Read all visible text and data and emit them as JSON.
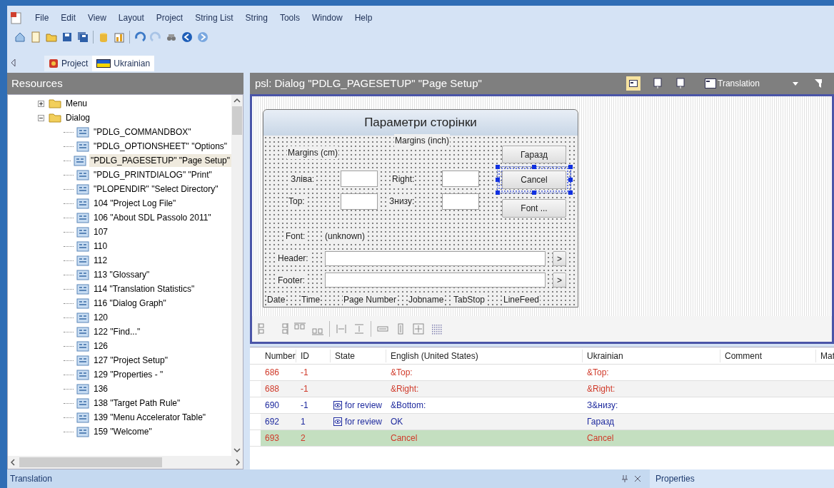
{
  "menu": {
    "items": [
      "File",
      "Edit",
      "View",
      "Layout",
      "Project",
      "String List",
      "String",
      "Tools",
      "Window",
      "Help"
    ]
  },
  "document_tabs": [
    {
      "label": "Project",
      "selected": false
    },
    {
      "label": "Ukrainian",
      "selected": true
    }
  ],
  "resources": {
    "title": "Resources",
    "tree": [
      {
        "label": "Menu",
        "expanded": false
      },
      {
        "label": "Dialog",
        "expanded": true,
        "children": [
          {
            "label": "\"PDLG_COMMANDBOX\"",
            "selected": false
          },
          {
            "label": "\"PDLG_OPTIONSHEET\" \"Options\"",
            "selected": false
          },
          {
            "label": "\"PDLG_PAGESETUP\" \"Page Setup\"",
            "selected": true
          },
          {
            "label": "\"PDLG_PRINTDIALOG\" \"Print\"",
            "selected": false
          },
          {
            "label": "\"PLOPENDIR\" \"Select Directory\"",
            "selected": false
          },
          {
            "label": "104 \"Project Log File\"",
            "selected": false
          },
          {
            "label": "106 \"About SDL Passolo 2011\"",
            "selected": false
          },
          {
            "label": "107",
            "selected": false
          },
          {
            "label": "110",
            "selected": false
          },
          {
            "label": "112",
            "selected": false
          },
          {
            "label": "113 \"Glossary\"",
            "selected": false
          },
          {
            "label": "114 \"Translation Statistics\"",
            "selected": false
          },
          {
            "label": "116 \"Dialog Graph\"",
            "selected": false
          },
          {
            "label": "120",
            "selected": false
          },
          {
            "label": "122 \"Find...\"",
            "selected": false
          },
          {
            "label": "126",
            "selected": false
          },
          {
            "label": "127 \"Project Setup\"",
            "selected": false
          },
          {
            "label": "129 \"Properties - \"",
            "selected": false
          },
          {
            "label": "136",
            "selected": false
          },
          {
            "label": "138 \"Target Path Rule\"",
            "selected": false
          },
          {
            "label": "139 \"Menu Accelerator Table\"",
            "selected": false
          },
          {
            "label": "159 \"Welcome\"",
            "selected": false
          }
        ]
      }
    ]
  },
  "editor": {
    "title": "psl: Dialog \"PDLG_PAGESETUP\" \"Page Setup\"",
    "view_button": "Translation",
    "dialog": {
      "title": "Параметри сторінки",
      "controls": [
        {
          "kind": "label",
          "text": "Margins (inch)"
        },
        {
          "kind": "label",
          "text": "Margins (cm)"
        },
        {
          "kind": "button",
          "text": "Гаразд",
          "selected": false
        },
        {
          "kind": "label",
          "text": "Зліва:"
        },
        {
          "kind": "edit"
        },
        {
          "kind": "label",
          "text": "Right:"
        },
        {
          "kind": "edit"
        },
        {
          "kind": "button",
          "text": "Cancel",
          "selected": true
        },
        {
          "kind": "label",
          "text": "Top:"
        },
        {
          "kind": "edit"
        },
        {
          "kind": "label",
          "text": "Знизу:"
        },
        {
          "kind": "edit"
        },
        {
          "kind": "button",
          "text": "Font ...",
          "selected": false
        },
        {
          "kind": "label",
          "text": "Font:"
        },
        {
          "kind": "label",
          "text": "(unknown)"
        },
        {
          "kind": "label",
          "text": "Header:"
        },
        {
          "kind": "edit"
        },
        {
          "kind": "button",
          "text": ">",
          "selected": false
        },
        {
          "kind": "label",
          "text": "Footer:"
        },
        {
          "kind": "edit"
        },
        {
          "kind": "button",
          "text": ">",
          "selected": false
        },
        {
          "kind": "label",
          "text": "Date"
        },
        {
          "kind": "label",
          "text": "Time"
        },
        {
          "kind": "label",
          "text": "Page Number"
        },
        {
          "kind": "label",
          "text": "Jobname"
        },
        {
          "kind": "label",
          "text": "TabStop"
        },
        {
          "kind": "label",
          "text": "LineFeed"
        }
      ]
    }
  },
  "table": {
    "columns": [
      "Number",
      "ID",
      "State",
      "English (United States)",
      "Ukrainian",
      "Comment",
      "Mat"
    ],
    "rows": [
      {
        "kind": "pending",
        "selected": false,
        "number": "686",
        "id": "-1",
        "english": "&Top:",
        "ukrainian": "&Top:"
      },
      {
        "kind": "pending",
        "selected": false,
        "number": "688",
        "id": "-1",
        "english": "&Right:",
        "ukrainian": "&Right:"
      },
      {
        "kind": "review",
        "selected": false,
        "number": "690",
        "id": "-1",
        "state": "for review",
        "english": "&Bottom:",
        "ukrainian": "З&низу:"
      },
      {
        "kind": "review",
        "selected": false,
        "number": "692",
        "id": "1",
        "state": "for review",
        "english": "OK",
        "ukrainian": "Гаразд"
      },
      {
        "kind": "pending",
        "selected": true,
        "number": "693",
        "id": "2",
        "english": "Cancel",
        "ukrainian": "Cancel"
      }
    ]
  },
  "status_bar": {
    "left": "Translation",
    "right_tab": "Properties"
  }
}
